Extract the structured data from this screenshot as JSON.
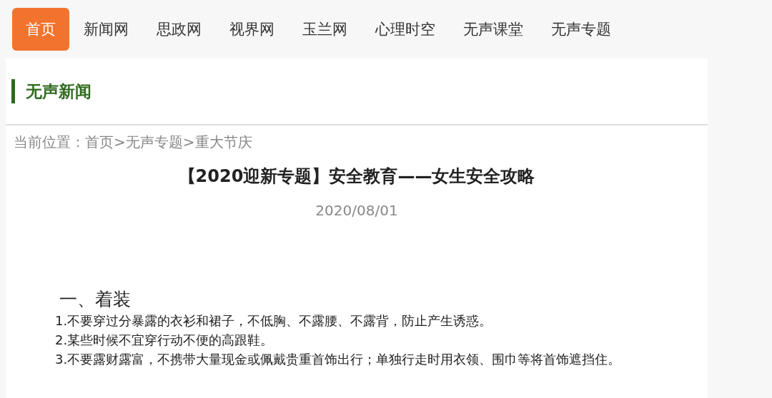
{
  "nav": [
    {
      "label": "首页",
      "selected": true
    },
    {
      "label": "新闻网",
      "selected": false
    },
    {
      "label": "思政网",
      "selected": false
    },
    {
      "label": "视界网",
      "selected": false
    },
    {
      "label": "玉兰网",
      "selected": false
    },
    {
      "label": "心理时空",
      "selected": false
    },
    {
      "label": "无声课堂",
      "selected": false
    },
    {
      "label": "无声专题",
      "selected": false
    }
  ],
  "section_title": "无声新闻",
  "breadcrumb": "当前位置：首页>无声专题>重大节庆",
  "article": {
    "title": "【2020迎新专题】安全教育——女生安全攻略",
    "date": "2020/08/01",
    "heading": "一、着装",
    "paragraphs": [
      "1.不要穿过分暴露的衣衫和裙子，不低胸、不露腰、不露背，防止产生诱惑。",
      "2.某些时候不宜穿行动不便的高跟鞋。",
      "3.不要露财露富，不携带大量现金或佩戴贵重首饰出行；单独行走时用衣领、围巾等将首饰遮挡住。"
    ]
  }
}
